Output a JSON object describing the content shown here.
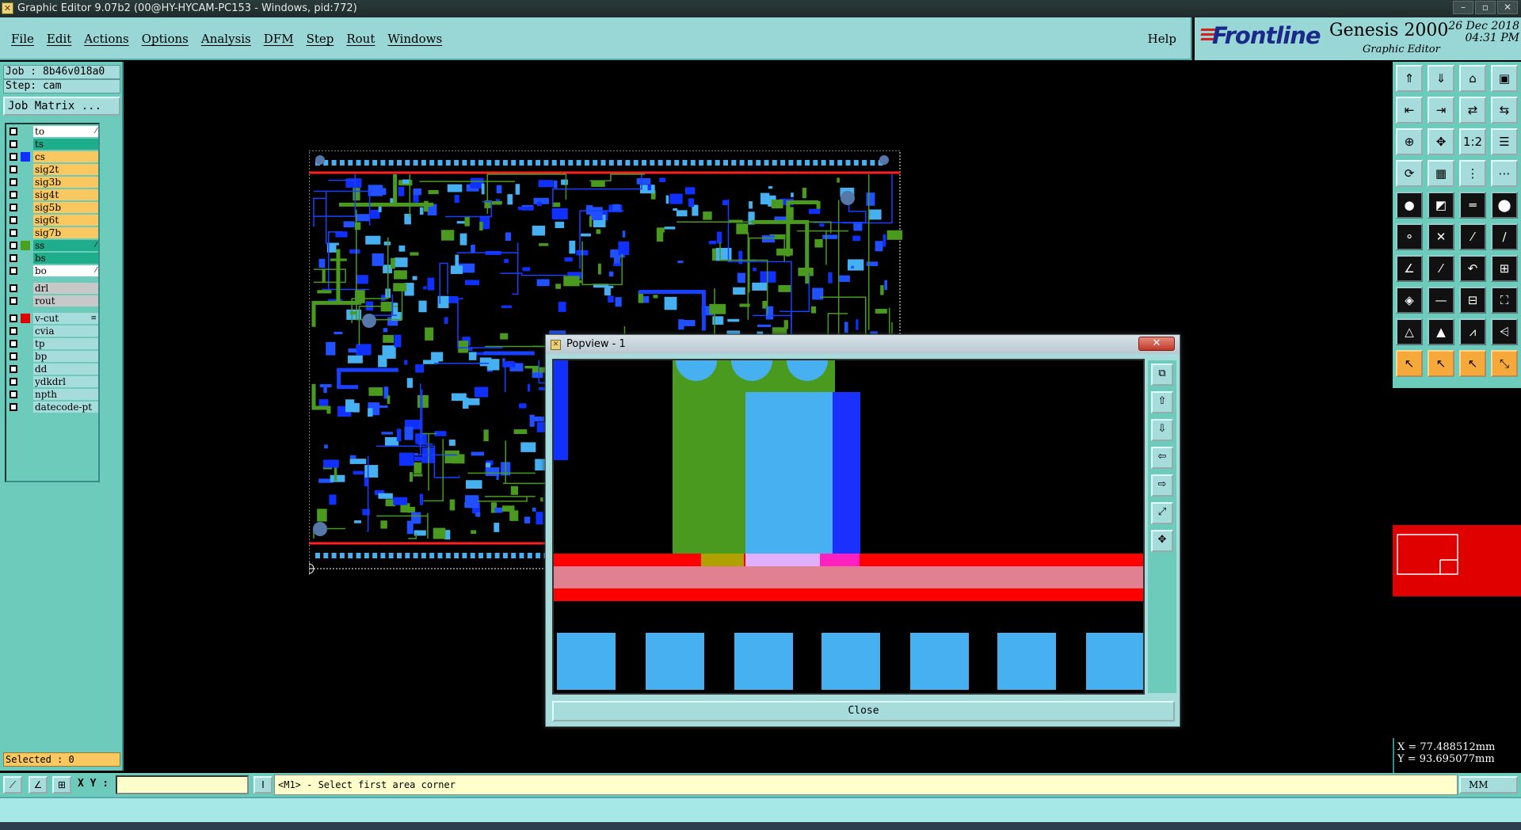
{
  "window": {
    "title": "Graphic Editor 9.07b2 (00@HY-HYCAM-PC153 - Windows, pid:772)",
    "controls": [
      "–",
      "▫",
      "✕"
    ]
  },
  "menu": {
    "items": [
      "File",
      "Edit",
      "Actions",
      "Options",
      "Analysis",
      "DFM",
      "Step",
      "Rout",
      "Windows"
    ],
    "help": "Help"
  },
  "brand": {
    "logo": "Frontline",
    "product": "Genesis 2000",
    "subtitle": "Graphic Editor",
    "date": "26 Dec 2018",
    "time": "04:31 PM"
  },
  "left": {
    "job": "Job : 8b46v018a0",
    "step": "Step: cam",
    "job_matrix": "Job Matrix ...",
    "selected": "Selected : 0",
    "layers": [
      {
        "name": "to",
        "color": "#ffffff",
        "swatch": "",
        "mark": "⁄"
      },
      {
        "name": "ts",
        "color": "#1fae8c",
        "swatch": "",
        "mark": ""
      },
      {
        "name": "cs",
        "color": "#f9c860",
        "swatch": "#1030ff",
        "mark": ""
      },
      {
        "name": "sig2t",
        "color": "#f9c860",
        "swatch": "",
        "mark": ""
      },
      {
        "name": "sig3b",
        "color": "#f9c860",
        "swatch": "",
        "mark": ""
      },
      {
        "name": "sig4t",
        "color": "#f9c860",
        "swatch": "",
        "mark": ""
      },
      {
        "name": "sig5b",
        "color": "#f9c860",
        "swatch": "",
        "mark": ""
      },
      {
        "name": "sig6t",
        "color": "#f9c860",
        "swatch": "",
        "mark": ""
      },
      {
        "name": "sig7b",
        "color": "#f9c860",
        "swatch": "",
        "mark": ""
      },
      {
        "name": "ss",
        "color": "#1fae8c",
        "swatch": "#4aa020",
        "mark": "⁄"
      },
      {
        "name": "bs",
        "color": "#1fae8c",
        "swatch": "",
        "mark": ""
      },
      {
        "name": "bo",
        "color": "#ffffff",
        "swatch": "",
        "mark": "⁄"
      },
      {
        "name": "drl",
        "color": "#c8c8c8",
        "swatch": "",
        "mark": ""
      },
      {
        "name": "rout",
        "color": "#c8c8c8",
        "swatch": "",
        "mark": ""
      },
      {
        "name": "v-cut",
        "color": "#a6dcdc",
        "swatch": "#e00000",
        "mark": "≡"
      },
      {
        "name": "cvia",
        "color": "#a6dcdc",
        "swatch": "",
        "mark": ""
      },
      {
        "name": "tp",
        "color": "#a6dcdc",
        "swatch": "",
        "mark": ""
      },
      {
        "name": "bp",
        "color": "#a6dcdc",
        "swatch": "",
        "mark": ""
      },
      {
        "name": "dd",
        "color": "#a6dcdc",
        "swatch": "",
        "mark": ""
      },
      {
        "name": "ydkdrl",
        "color": "#a6dcdc",
        "swatch": "",
        "mark": ""
      },
      {
        "name": "npth",
        "color": "#a6dcdc",
        "swatch": "",
        "mark": ""
      },
      {
        "name": "datecode-pt",
        "color": "#a6dcdc",
        "swatch": "",
        "mark": ""
      }
    ]
  },
  "popview": {
    "title": "Popview - 1",
    "close_label": "Close",
    "close_x": "✕",
    "tools": [
      "⧉",
      "⇧",
      "⇩",
      "⇦",
      "⇨",
      "⤢",
      "✥"
    ]
  },
  "tools": {
    "rows": [
      [
        "⇑",
        "⇓",
        "⌂",
        "▣"
      ],
      [
        "⇤",
        "⇥",
        "⇄",
        "⇆"
      ],
      [
        "⊕",
        "✥",
        "1:2",
        "☰"
      ],
      [
        "⟳",
        "▦",
        "⋮",
        "⋯"
      ],
      [
        "●",
        "◩",
        "═",
        "⬤"
      ],
      [
        "⚬",
        "✕",
        "⁄",
        "∕"
      ],
      [
        "∠",
        "⁄",
        "↶",
        "⊞"
      ],
      [
        "◈",
        "—",
        "⊟",
        "⛶"
      ],
      [
        "△",
        "▲",
        "⩘",
        "⩤"
      ],
      [
        "↖",
        "↖",
        "↖",
        "⤡"
      ]
    ],
    "dark_rows": [
      4,
      5,
      6,
      7,
      8
    ],
    "orange_row": 9
  },
  "coords": {
    "x": "X = 77.488512mm",
    "y": "Y = 93.695077mm"
  },
  "bottom": {
    "xy_label": "X Y :",
    "xy_value": "",
    "prompt": "<M1> - Select first area corner",
    "units": "MM"
  }
}
